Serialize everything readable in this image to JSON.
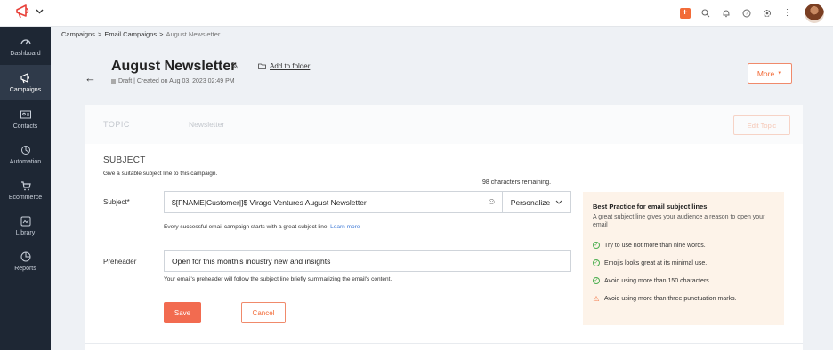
{
  "sidebar": {
    "items": [
      {
        "label": "Dashboard",
        "icon": "dashboard-icon"
      },
      {
        "label": "Campaigns",
        "icon": "megaphone-icon"
      },
      {
        "label": "Contacts",
        "icon": "contacts-icon"
      },
      {
        "label": "Automation",
        "icon": "automation-icon"
      },
      {
        "label": "Ecommerce",
        "icon": "cart-icon"
      },
      {
        "label": "Library",
        "icon": "library-icon"
      },
      {
        "label": "Reports",
        "icon": "reports-icon"
      }
    ]
  },
  "breadcrumb": {
    "items": [
      "Campaigns",
      "Email Campaigns",
      "August Newsletter"
    ],
    "sep": ">"
  },
  "header": {
    "title": "August Newsletter",
    "add_folder": "Add to folder",
    "status": "Draft | Created on Aug 03, 2023 02:49 PM",
    "more": "More"
  },
  "topic": {
    "label": "TOPIC",
    "value": "Newsletter",
    "edit": "Edit Topic"
  },
  "subject": {
    "heading": "SUBJECT",
    "hint": "Give a suitable subject line to this campaign.",
    "chars_remaining": "98 characters remaining.",
    "label": "Subject*",
    "value": "$[FNAME|Customer|]$ Virago Ventures August Newsletter",
    "personalize": "Personalize",
    "help": "Every successful email campaign starts with a great subject line.",
    "learn_more": "Learn more"
  },
  "preheader": {
    "label": "Preheader",
    "value": "Open for this month's industry new and insights",
    "help": "Your email's preheader will follow the subject line briefly summarizing the email's content."
  },
  "actions": {
    "save": "Save",
    "cancel": "Cancel"
  },
  "best_practice": {
    "title": "Best Practice for email subject lines",
    "subtitle": "A great subject line gives your audience a reason to open your email",
    "items": [
      "Try to use not more than nine words.",
      "Emojis looks great at its minimal use.",
      "Avoid using more than 150 characters.",
      "Avoid using more than three punctuation marks."
    ]
  },
  "colors": {
    "accent": "#f26b38",
    "sidebar": "#1e2734",
    "tip_bg": "#fdf3e9"
  }
}
